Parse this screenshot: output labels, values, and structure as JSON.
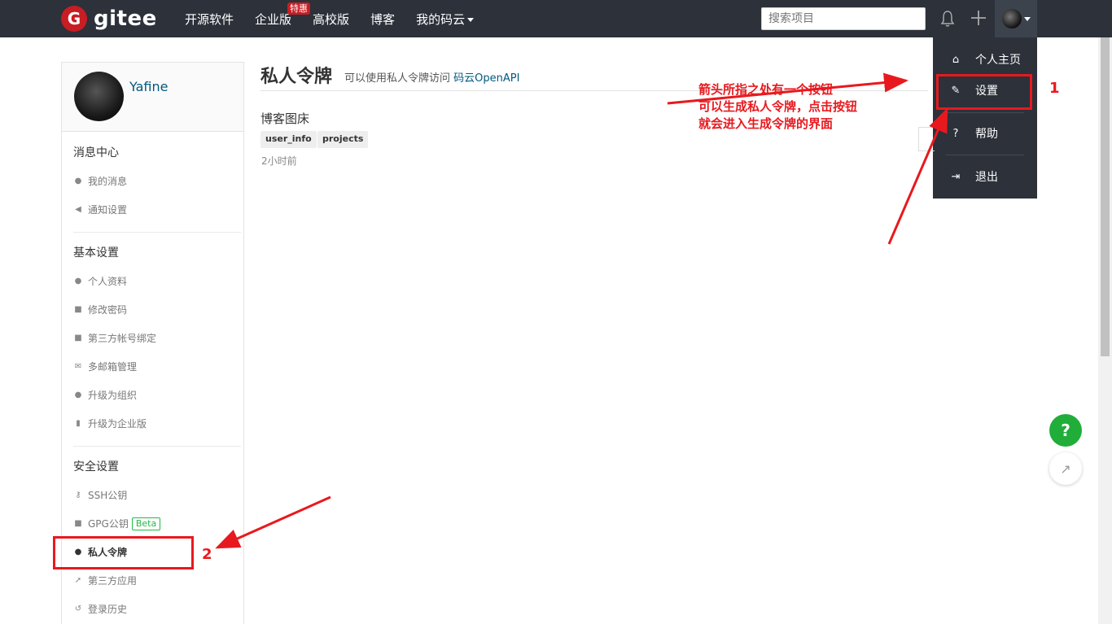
{
  "brand": {
    "logo_letter": "G",
    "name": "gitee"
  },
  "nav": {
    "items": [
      "开源软件",
      "企业版",
      "高校版",
      "博客",
      "我的码云"
    ],
    "badge": "特惠"
  },
  "search": {
    "placeholder": "搜索项目"
  },
  "dropdown": {
    "items": [
      {
        "label": "个人主页",
        "icon": "home-icon"
      },
      {
        "label": "设置",
        "icon": "edit-icon"
      },
      {
        "label": "帮助",
        "icon": "help-icon"
      },
      {
        "label": "退出",
        "icon": "logout-icon"
      }
    ]
  },
  "profile": {
    "username": "Yafine"
  },
  "sidebar": {
    "sections": [
      {
        "title": "消息中心",
        "items": [
          "我的消息",
          "通知设置"
        ]
      },
      {
        "title": "基本设置",
        "items": [
          "个人资料",
          "修改密码",
          "第三方帐号绑定",
          "多邮箱管理",
          "升级为组织",
          "升级为企业版"
        ]
      },
      {
        "title": "安全设置",
        "items": [
          "SSH公钥",
          "GPG公钥",
          "私人令牌",
          "第三方应用",
          "登录历史"
        ]
      }
    ],
    "beta_label": "Beta"
  },
  "main": {
    "title": "私人令牌",
    "subtitle": "可以使用私人令牌访问",
    "subtitle_link": "码云OpenAPI",
    "token": {
      "name": "博客图床",
      "scopes": [
        "user_info",
        "projects"
      ],
      "time": "2小时前"
    }
  },
  "annotations": {
    "text_lines": [
      "箭头所指之处有一个按钮",
      "可以生成私人令牌，点击按钮",
      "就会进入生成令牌的界面"
    ],
    "num1": "1",
    "num2": "2",
    "color": "#e8191e"
  },
  "float": {
    "help": "?"
  }
}
